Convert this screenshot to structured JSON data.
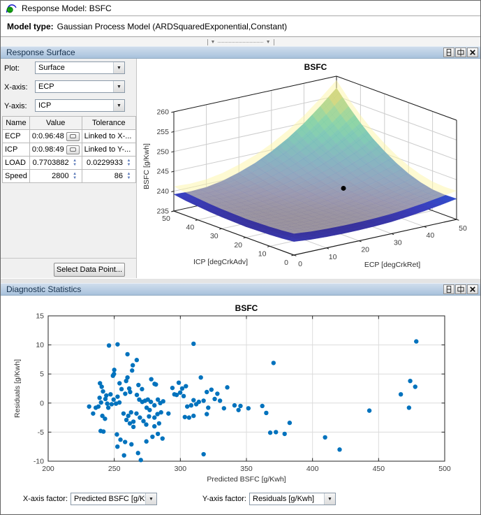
{
  "window": {
    "title": "Response Model: BSFC",
    "model_type_label": "Model type:",
    "model_type_value": "Gaussian Process Model (ARDSquaredExponential,Constant)"
  },
  "response_surface_panel": {
    "title": "Response Surface",
    "controls": [
      {
        "label": "Plot:",
        "value": "Surface"
      },
      {
        "label": "X-axis:",
        "value": "ECP"
      },
      {
        "label": "Y-axis:",
        "value": "ICP"
      }
    ],
    "factor_table": {
      "headers": [
        "Name",
        "Value",
        "Tolerance"
      ],
      "rows": [
        {
          "name": "ECP",
          "value": "0:0.96:48",
          "value_control": "button",
          "tolerance": "Linked to X-...",
          "tolerance_control": "none"
        },
        {
          "name": "ICP",
          "value": "0:0.98:49",
          "value_control": "button",
          "tolerance": "Linked to Y-...",
          "tolerance_control": "none"
        },
        {
          "name": "LOAD",
          "value": "0.7703882",
          "value_control": "spinner",
          "tolerance": "0.0229933",
          "tolerance_control": "spinner"
        },
        {
          "name": "Speed",
          "value": "2800",
          "value_control": "spinner",
          "tolerance": "86",
          "tolerance_control": "spinner"
        }
      ]
    },
    "select_data_point_label": "Select Data Point..."
  },
  "diagnostic_panel": {
    "title": "Diagnostic Statistics",
    "x_factor_label": "X-axis factor:",
    "x_factor_value": "Predicted BSFC [g/Kwh]",
    "y_factor_label": "Y-axis factor:",
    "y_factor_value": "Residuals [g/Kwh]"
  },
  "colors": {
    "accent_marker": "#0072BD",
    "panel_header_top": "#cfdded",
    "panel_header_bottom": "#a8c2dc",
    "upper_surface": "#fdf6a6",
    "grid_line": "#dcdcdc",
    "axis_line": "#262626",
    "surface_colormap": [
      "#352a87",
      "#3a3dbb",
      "#2a59d8",
      "#156fde",
      "#0b86d4",
      "#06a0c6",
      "#1cb3ac",
      "#5dbb8a",
      "#9dbe67",
      "#e9a83f",
      "#fcc02e"
    ]
  },
  "chart_data": [
    {
      "type": "surface",
      "title": "BSFC",
      "xlabel": "ECP [degCrkRet]",
      "ylabel": "ICP [degCrkAdv]",
      "zlabel": "BSFC [g/Kwh]",
      "xlim": [
        0,
        50
      ],
      "ylim": [
        0,
        50
      ],
      "zlim": [
        235,
        260
      ],
      "xticks": [
        0,
        10,
        20,
        30,
        40,
        50
      ],
      "yticks": [
        0,
        10,
        20,
        30,
        40,
        50
      ],
      "zticks": [
        235,
        240,
        245,
        250,
        255,
        260
      ],
      "color_axis": [
        236.5,
        259.5
      ],
      "upper_bound_offset": 2,
      "marker_point": {
        "x": 30,
        "y": 20,
        "z": 242
      },
      "x": [
        0,
        5,
        10,
        15,
        20,
        25,
        30,
        35,
        40,
        45,
        50
      ],
      "y": [
        0,
        5,
        10,
        15,
        20,
        25,
        30,
        35,
        40,
        45,
        50
      ],
      "z": [
        [
          238.4,
          238.0,
          237.8,
          237.7,
          237.7,
          237.8,
          238.0,
          238.4,
          238.9,
          239.5,
          240.2
        ],
        [
          238.1,
          237.7,
          237.5,
          237.4,
          237.4,
          237.5,
          237.8,
          238.2,
          238.7,
          239.3,
          240.1
        ],
        [
          237.9,
          237.5,
          237.3,
          237.2,
          237.3,
          237.5,
          237.8,
          238.2,
          238.8,
          239.5,
          240.3
        ],
        [
          237.8,
          237.4,
          237.2,
          237.2,
          237.3,
          237.5,
          237.9,
          238.5,
          239.2,
          240.0,
          241.0
        ],
        [
          237.7,
          237.4,
          237.2,
          237.2,
          237.4,
          237.8,
          238.3,
          239.0,
          239.9,
          240.9,
          242.1
        ],
        [
          237.8,
          237.5,
          237.3,
          237.4,
          237.7,
          238.2,
          238.9,
          239.7,
          240.8,
          242.1,
          243.6
        ],
        [
          237.9,
          237.6,
          237.5,
          237.7,
          238.1,
          238.7,
          239.6,
          240.7,
          242.1,
          243.6,
          245.5
        ],
        [
          238.1,
          237.8,
          237.8,
          238.1,
          238.6,
          239.5,
          240.5,
          241.9,
          243.6,
          245.5,
          247.7
        ],
        [
          238.4,
          238.1,
          238.2,
          238.6,
          239.3,
          240.4,
          241.7,
          243.4,
          245.4,
          247.8,
          250.4
        ],
        [
          238.7,
          238.5,
          238.7,
          239.2,
          240.1,
          241.4,
          243.0,
          245.1,
          247.5,
          250.3,
          253.5
        ],
        [
          239.2,
          239.0,
          239.2,
          239.9,
          241.1,
          242.6,
          244.6,
          247.0,
          249.9,
          253.3,
          257.0
        ]
      ]
    },
    {
      "type": "scatter",
      "title": "BSFC",
      "xlabel": "Predicted BSFC [g/Kwh]",
      "ylabel": "Residuals [g/Kwh]",
      "xlim": [
        200,
        500
      ],
      "ylim": [
        -10,
        15
      ],
      "xticks": [
        200,
        250,
        300,
        350,
        400,
        450,
        500
      ],
      "yticks": [
        -10,
        -5,
        0,
        5,
        10,
        15
      ],
      "marker_color": "#0072BD",
      "points": [
        [
          246,
          9.9
        ],
        [
          252.5,
          10.1
        ],
        [
          310,
          10.2
        ],
        [
          478.5,
          10.6
        ],
        [
          260,
          8.4
        ],
        [
          267,
          7.4
        ],
        [
          370.5,
          6.9
        ],
        [
          264,
          6.5
        ],
        [
          263.5,
          5.6
        ],
        [
          250,
          5.7
        ],
        [
          249.8,
          5.0
        ],
        [
          249,
          4.7
        ],
        [
          260,
          4.4
        ],
        [
          259,
          3.8
        ],
        [
          278,
          4.1
        ],
        [
          315.5,
          4.4
        ],
        [
          239.2,
          3.4
        ],
        [
          240.5,
          2.8
        ],
        [
          254,
          3.4
        ],
        [
          261.3,
          2.5
        ],
        [
          268.3,
          3.1
        ],
        [
          271,
          2.4
        ],
        [
          280.5,
          3.3
        ],
        [
          281.5,
          3.2
        ],
        [
          335.5,
          2.7
        ],
        [
          294,
          2.6
        ],
        [
          298.8,
          3.5
        ],
        [
          301.4,
          2.5
        ],
        [
          304.2,
          2.9
        ],
        [
          241.5,
          2.0
        ],
        [
          244,
          1.3
        ],
        [
          247.2,
          1.5
        ],
        [
          249.5,
          0.6
        ],
        [
          251.3,
          -0.1
        ],
        [
          252.5,
          1.1
        ],
        [
          253.9,
          0.1
        ],
        [
          255.5,
          2.4
        ],
        [
          258.3,
          1.6
        ],
        [
          262,
          1.9
        ],
        [
          295.5,
          1.5
        ],
        [
          297.2,
          1.4
        ],
        [
          299.9,
          1.8
        ],
        [
          302.5,
          1.2
        ],
        [
          310,
          0.5
        ],
        [
          314,
          0.2
        ],
        [
          317.6,
          0.4
        ],
        [
          320,
          1.9
        ],
        [
          323.5,
          2.3
        ],
        [
          326,
          0.7
        ],
        [
          328,
          1.6
        ],
        [
          267.1,
          1.4
        ],
        [
          268.9,
          0.6
        ],
        [
          271.2,
          0.2
        ],
        [
          273.3,
          0.4
        ],
        [
          275.4,
          0.6
        ],
        [
          277.7,
          0.2
        ],
        [
          280.4,
          -0.4
        ],
        [
          283,
          0.6
        ],
        [
          284.8,
          0.0
        ],
        [
          287,
          0.3
        ],
        [
          231,
          -0.6
        ],
        [
          234,
          -1.8
        ],
        [
          236,
          -0.8
        ],
        [
          238,
          -0.6
        ],
        [
          238.9,
          0.9
        ],
        [
          240,
          0.1
        ],
        [
          243.3,
          0.7
        ],
        [
          244.7,
          -0.1
        ],
        [
          245.5,
          -0.8
        ],
        [
          248,
          -0.2
        ],
        [
          305.2,
          -0.6
        ],
        [
          308.2,
          -0.4
        ],
        [
          312,
          -0.2
        ],
        [
          321.1,
          -0.8
        ],
        [
          330,
          0.4
        ],
        [
          333,
          -0.9
        ],
        [
          341,
          -0.4
        ],
        [
          344,
          -1.2
        ],
        [
          345.5,
          -0.5
        ],
        [
          351.5,
          -0.9
        ],
        [
          274.5,
          -0.8
        ],
        [
          276.8,
          -1.2
        ],
        [
          266.8,
          -1.8
        ],
        [
          262.7,
          -1.6
        ],
        [
          260.6,
          -2.2
        ],
        [
          257,
          -1.8
        ],
        [
          291,
          -1.8
        ],
        [
          303.4,
          -2.4
        ],
        [
          306.6,
          -2.5
        ],
        [
          310,
          -2.2
        ],
        [
          320,
          -1.9
        ],
        [
          241,
          -2.2
        ],
        [
          243,
          -2.7
        ],
        [
          259.2,
          -2.9
        ],
        [
          261.8,
          -3.5
        ],
        [
          264.5,
          -3.2
        ],
        [
          269.4,
          -2.5
        ],
        [
          272.1,
          -3.1
        ],
        [
          274.2,
          -3.7
        ],
        [
          276.3,
          -2.3
        ],
        [
          280.4,
          -2.5
        ],
        [
          282.7,
          -1.9
        ],
        [
          285.4,
          -1.6
        ],
        [
          264.5,
          -4.1
        ],
        [
          280.4,
          -4.0
        ],
        [
          283.9,
          -3.5
        ],
        [
          239.7,
          -4.8
        ],
        [
          241.8,
          -4.9
        ],
        [
          252,
          -5.4
        ],
        [
          254.7,
          -6.3
        ],
        [
          258.2,
          -6.7
        ],
        [
          283,
          -5.3
        ],
        [
          278.9,
          -5.8
        ],
        [
          286.5,
          -6.1
        ],
        [
          252.4,
          -7.5
        ],
        [
          257.4,
          -9.0
        ],
        [
          263,
          -7.1
        ],
        [
          268,
          -8.6
        ],
        [
          270.1,
          -9.8
        ],
        [
          274.3,
          -6.6
        ],
        [
          317.6,
          -8.8
        ],
        [
          362,
          -0.5
        ],
        [
          365,
          -1.7
        ],
        [
          368,
          -5.1
        ],
        [
          372.3,
          -5.0
        ],
        [
          378.9,
          -5.3
        ],
        [
          382.7,
          -3.4
        ],
        [
          409.5,
          -5.9
        ],
        [
          420.5,
          -8.0
        ],
        [
          443,
          -1.3
        ],
        [
          466.8,
          1.5
        ],
        [
          473.9,
          3.8
        ],
        [
          477.7,
          2.8
        ],
        [
          473,
          -0.8
        ]
      ]
    }
  ]
}
